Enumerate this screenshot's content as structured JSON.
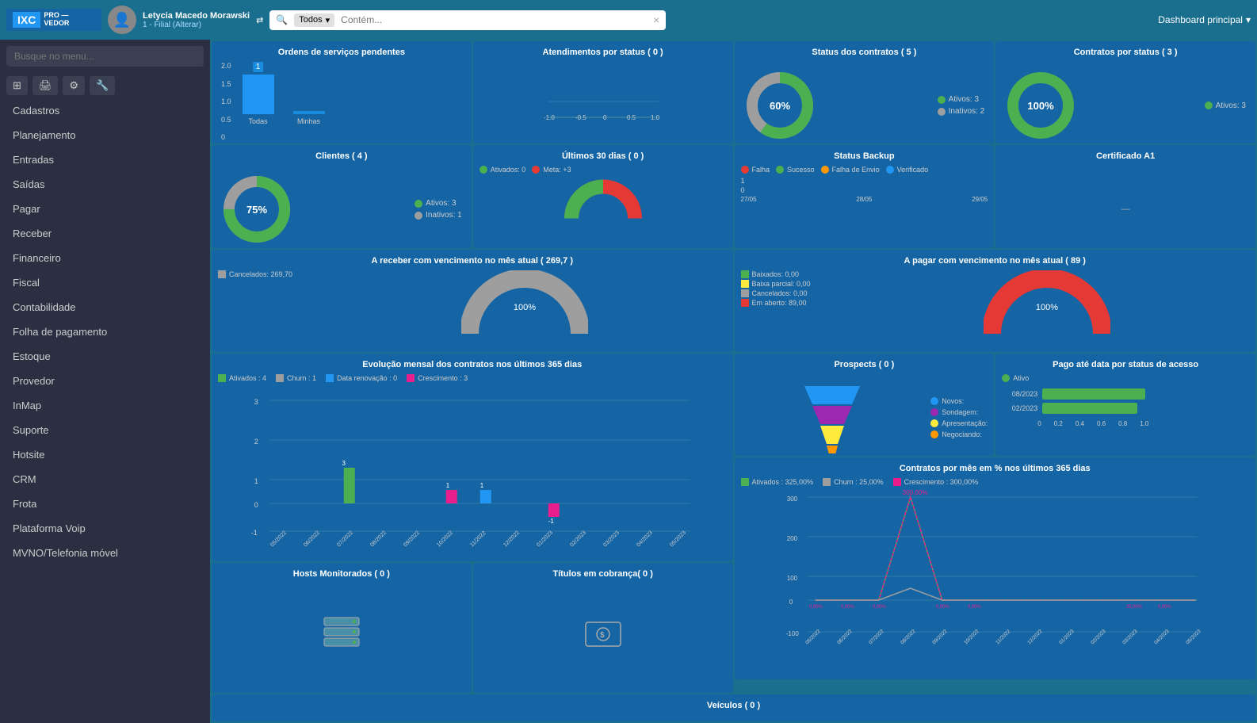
{
  "topbar": {
    "logo_ixc": "IXC",
    "logo_pro": "PRO —\nVEDOR",
    "user_name": "Letycia Macedo Morawski",
    "user_branch": "1 - Filial (Alterar)",
    "search_filter": "Todos",
    "search_placeholder": "Contém...",
    "search_clear": "×",
    "dashboard_title": "Dashboard principal",
    "dropdown_icon": "▾"
  },
  "sidebar": {
    "search_placeholder": "Busque no menu...",
    "menu_items": [
      "Cadastros",
      "Planejamento",
      "Entradas",
      "Saídas",
      "Pagar",
      "Receber",
      "Financeiro",
      "Fiscal",
      "Contabilidade",
      "Folha de pagamento",
      "Estoque",
      "Provedor",
      "InMap",
      "Suporte",
      "Hotsite",
      "CRM",
      "Frota",
      "Plataforma Voip",
      "MVNO/Telefonia móvel"
    ],
    "toolbar_icons": [
      "☰",
      "🖨",
      "⚙",
      "🔧"
    ]
  },
  "widgets": {
    "ordens_servico": {
      "title": "Ordens de serviços pendentes",
      "bar_todas": 1,
      "bar_minhas": 0,
      "label_todas": "Todas",
      "label_minhas": "Minhas",
      "y_labels": [
        "2.0",
        "1.5",
        "1.0",
        "0.5",
        "0"
      ]
    },
    "atendimentos": {
      "title": "Atendimentos por status ( 0 )"
    },
    "status_contratos": {
      "title": "Status dos contratos ( 5 )",
      "ativos": 3,
      "inativos": 2,
      "percent": "60%",
      "color_ativos": "#4caf50",
      "color_inativos": "#9e9e9e"
    },
    "contratos_status": {
      "title": "Contratos por status ( 3 )",
      "ativos": 3,
      "percent": "100%",
      "color_ativos": "#4caf50"
    },
    "clientes": {
      "title": "Clientes ( 4 )",
      "ativos": 3,
      "inativos": 1,
      "percent": "75%",
      "color_ativos": "#4caf50",
      "color_inativos": "#9e9e9e"
    },
    "ultimos_30_dias": {
      "title": "Últimos 30 dias ( 0 )",
      "ativados": 0,
      "meta": "+3",
      "label_ativados": "Ativados: 0",
      "label_meta": "Meta: +3"
    },
    "status_backup": {
      "title": "Status Backup",
      "legend": [
        "Falha",
        "Sucesso",
        "Falha de Envio",
        "Verificado"
      ],
      "x_labels": [
        "27/05",
        "28/05",
        "29/05"
      ],
      "y_labels": [
        "1",
        "0"
      ]
    },
    "certificado_a1": {
      "title": "Certificado A1"
    },
    "a_receber": {
      "title": "A receber com vencimento no mês atual ( 269,7 )",
      "cancelados": "Cancelados: 269,70",
      "percent": "100%"
    },
    "a_pagar": {
      "title": "A pagar com vencimento no mês atual ( 89 )",
      "baixados": "Baixados: 0,00",
      "baixa_parcial": "Baixa parcial: 0,00",
      "cancelados": "Cancelados: 0,00",
      "em_aberto": "Em aberto: 89,00",
      "percent": "100%"
    },
    "evolucao_mensal": {
      "title": "Evolução mensal dos contratos nos últimos 365 dias",
      "legend": [
        {
          "label": "Ativados : 4",
          "color": "#4caf50"
        },
        {
          "label": "Churn : 1",
          "color": "#9e9e9e"
        },
        {
          "label": "Data renovação : 0",
          "color": "#2196f3"
        },
        {
          "label": "Crescimento : 3",
          "color": "#e91e8c"
        }
      ],
      "x_labels": [
        "05/2022",
        "06/2022",
        "07/2022",
        "08/2022",
        "09/2022",
        "10/2022",
        "11/2022",
        "12/2022",
        "01/2023",
        "02/2023",
        "03/2023",
        "04/2023",
        "05/2023"
      ],
      "y_labels": [
        "3",
        "2",
        "1",
        "0",
        "-1"
      ]
    },
    "prospects": {
      "title": "Prospects ( 0 )",
      "legend": [
        {
          "label": "Novos:",
          "color": "#2196f3"
        },
        {
          "label": "Sondagem:",
          "color": "#9c27b0"
        },
        {
          "label": "Apresentação:",
          "color": "#ffeb3b"
        },
        {
          "label": "Negociando:",
          "color": "#ff9800"
        }
      ]
    },
    "pago_data": {
      "title": "Pago até data por status de acesso",
      "legend_label": "Ativo",
      "legend_color": "#4caf50",
      "bars": [
        {
          "label": "08/2023",
          "value": 0.9
        },
        {
          "label": "02/2023",
          "value": 0.85
        }
      ],
      "x_labels": [
        "0",
        "0.2",
        "0.4",
        "0.6",
        "0.8",
        "1.0"
      ]
    },
    "contratos_pct": {
      "title": "Contratos por mês em % nos últimos 365 dias",
      "legend": [
        {
          "label": "Ativados : 325,00%",
          "color": "#4caf50"
        },
        {
          "label": "Churn : 25,00%",
          "color": "#9e9e9e"
        },
        {
          "label": "Crescimento : 300,00%",
          "color": "#e91e8c"
        }
      ],
      "peak_label": "300,00%",
      "x_labels": [
        "05/2022",
        "06/2022",
        "07/2022",
        "08/2022",
        "09/2022",
        "10/2022",
        "11/2022",
        "12/2022",
        "01/2023",
        "02/2023",
        "03/2023",
        "04/2023",
        "05/2023"
      ],
      "y_labels": [
        "300",
        "200",
        "100",
        "0",
        "-100"
      ]
    },
    "hosts": {
      "title": "Hosts Monitorados ( 0 )"
    },
    "titulos": {
      "title": "Títulos em cobrança( 0 )"
    },
    "veiculos": {
      "title": "Veículos ( 0 )"
    }
  }
}
